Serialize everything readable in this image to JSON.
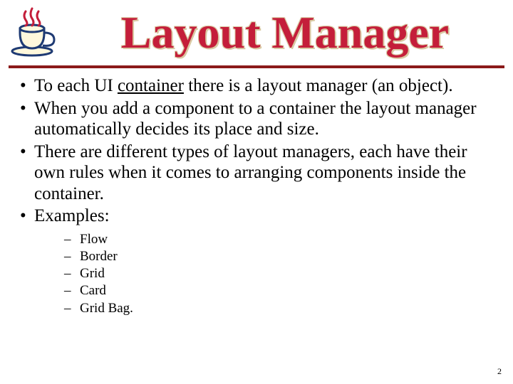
{
  "title": "Layout Manager",
  "icon_name": "coffee-cup-icon",
  "bullets": [
    {
      "pre": "To each UI ",
      "u": "container",
      "post": " there is a layout manager (an object)."
    },
    {
      "pre": "When you add a component to a container the layout manager automatically decides its place and size.",
      "u": "",
      "post": ""
    },
    {
      "pre": "There are different types of layout managers, each have their own rules when it comes to arranging components inside the container.",
      "u": "",
      "post": ""
    }
  ],
  "examples_label": "Examples:",
  "examples": [
    "Flow",
    "Border",
    "Grid",
    "Card",
    "Grid Bag."
  ],
  "page_number": "2"
}
